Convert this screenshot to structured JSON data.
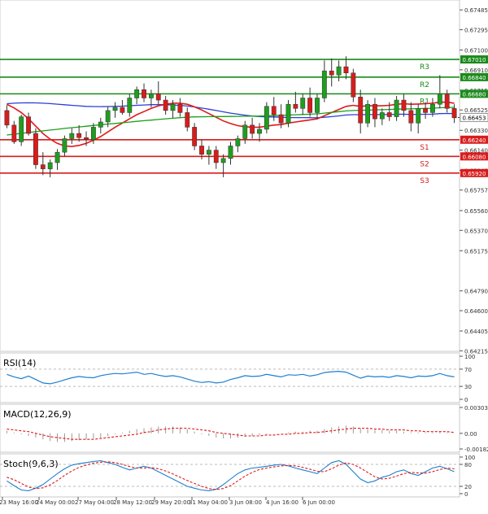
{
  "chart_data": [
    {
      "type": "candlestick",
      "title": "",
      "ylim": [
        0.6421,
        0.6758
      ],
      "y_ticks": [
        "0.67485",
        "0.67295",
        "0.67100",
        "0.66910",
        "0.66715",
        "0.66525",
        "0.66330",
        "0.66140",
        "0.65945",
        "0.65757",
        "0.65560",
        "0.65370",
        "0.65175",
        "0.64790",
        "0.64600",
        "0.64405",
        "0.64215"
      ],
      "x_ticks": [
        "23 May 16:00",
        "24 May 00:00",
        "27 May 04:00",
        "28 May 12:00",
        "29 May 20:00",
        "31 May 04:00",
        "3 Jun 08:00",
        "4 Jun 16:00",
        "6 Jun 00:00"
      ],
      "current_price": "0.66453",
      "levels": [
        {
          "name": "R3",
          "value": 0.6701,
          "label": "0.67010",
          "kind": "resistance"
        },
        {
          "name": "R2",
          "value": 0.6684,
          "label": "0.66840",
          "kind": "resistance"
        },
        {
          "name": "R1",
          "value": 0.6668,
          "label": "0.66680",
          "kind": "resistance"
        },
        {
          "name": "S1",
          "value": 0.6624,
          "label": "0.66240",
          "kind": "support"
        },
        {
          "name": "S2",
          "value": 0.6608,
          "label": "0.66080",
          "kind": "support"
        },
        {
          "name": "S3",
          "value": 0.6592,
          "label": "0.65920",
          "kind": "support"
        }
      ],
      "candles": [
        [
          0.6652,
          0.6657,
          0.6635,
          0.6638
        ],
        [
          0.6638,
          0.6642,
          0.662,
          0.6622
        ],
        [
          0.6622,
          0.6648,
          0.6618,
          0.6646
        ],
        [
          0.6646,
          0.665,
          0.6628,
          0.663
        ],
        [
          0.663,
          0.6635,
          0.6596,
          0.66
        ],
        [
          0.66,
          0.6612,
          0.659,
          0.6596
        ],
        [
          0.6596,
          0.6605,
          0.6588,
          0.6602
        ],
        [
          0.6602,
          0.6615,
          0.6595,
          0.6612
        ],
        [
          0.6612,
          0.6628,
          0.6608,
          0.6625
        ],
        [
          0.6625,
          0.6635,
          0.662,
          0.663
        ],
        [
          0.663,
          0.6638,
          0.6622,
          0.6626
        ],
        [
          0.6626,
          0.6632,
          0.6618,
          0.6624
        ],
        [
          0.6624,
          0.664,
          0.662,
          0.6636
        ],
        [
          0.6636,
          0.6645,
          0.663,
          0.6641
        ],
        [
          0.6641,
          0.6656,
          0.6636,
          0.6652
        ],
        [
          0.6652,
          0.666,
          0.6645,
          0.6655
        ],
        [
          0.6655,
          0.6662,
          0.6648,
          0.665
        ],
        [
          0.665,
          0.6668,
          0.6646,
          0.6664
        ],
        [
          0.6664,
          0.6675,
          0.6658,
          0.6672
        ],
        [
          0.6672,
          0.6678,
          0.666,
          0.6664
        ],
        [
          0.6664,
          0.6672,
          0.6655,
          0.6668
        ],
        [
          0.6668,
          0.668,
          0.6658,
          0.6662
        ],
        [
          0.6662,
          0.6666,
          0.6648,
          0.6652
        ],
        [
          0.6652,
          0.6662,
          0.6645,
          0.6658
        ],
        [
          0.6658,
          0.6664,
          0.6646,
          0.665
        ],
        [
          0.665,
          0.6655,
          0.6632,
          0.6636
        ],
        [
          0.6636,
          0.664,
          0.6614,
          0.6618
        ],
        [
          0.6618,
          0.6624,
          0.6605,
          0.661
        ],
        [
          0.661,
          0.6618,
          0.66,
          0.6614
        ],
        [
          0.6614,
          0.6618,
          0.6596,
          0.6602
        ],
        [
          0.6602,
          0.661,
          0.6588,
          0.6606
        ],
        [
          0.6606,
          0.6622,
          0.66,
          0.6618
        ],
        [
          0.6618,
          0.6628,
          0.6612,
          0.6625
        ],
        [
          0.6625,
          0.6642,
          0.662,
          0.6638
        ],
        [
          0.6638,
          0.6645,
          0.6625,
          0.663
        ],
        [
          0.663,
          0.664,
          0.6622,
          0.6634
        ],
        [
          0.6634,
          0.666,
          0.663,
          0.6656
        ],
        [
          0.6656,
          0.6665,
          0.6642,
          0.6648
        ],
        [
          0.6648,
          0.6658,
          0.6635,
          0.664
        ],
        [
          0.664,
          0.6662,
          0.6636,
          0.6658
        ],
        [
          0.6658,
          0.667,
          0.665,
          0.6654
        ],
        [
          0.6654,
          0.6668,
          0.6648,
          0.6664
        ],
        [
          0.6664,
          0.6674,
          0.6646,
          0.665
        ],
        [
          0.665,
          0.6668,
          0.6644,
          0.6664
        ],
        [
          0.6664,
          0.67,
          0.666,
          0.669
        ],
        [
          0.669,
          0.6702,
          0.6675,
          0.6686
        ],
        [
          0.6686,
          0.67,
          0.668,
          0.6694
        ],
        [
          0.6694,
          0.6704,
          0.6682,
          0.6688
        ],
        [
          0.6688,
          0.6692,
          0.666,
          0.6665
        ],
        [
          0.6665,
          0.6672,
          0.663,
          0.664
        ],
        [
          0.664,
          0.6662,
          0.6636,
          0.6658
        ],
        [
          0.6658,
          0.6664,
          0.6636,
          0.6644
        ],
        [
          0.6644,
          0.6654,
          0.6638,
          0.665
        ],
        [
          0.665,
          0.666,
          0.6642,
          0.6646
        ],
        [
          0.6646,
          0.6666,
          0.6642,
          0.6662
        ],
        [
          0.6662,
          0.6668,
          0.6646,
          0.6652
        ],
        [
          0.6652,
          0.666,
          0.6632,
          0.664
        ],
        [
          0.664,
          0.6658,
          0.663,
          0.6654
        ],
        [
          0.6654,
          0.666,
          0.6644,
          0.665
        ],
        [
          0.665,
          0.6664,
          0.6646,
          0.6658
        ],
        [
          0.6658,
          0.6686,
          0.6654,
          0.6668
        ],
        [
          0.6668,
          0.6672,
          0.665,
          0.6654
        ],
        [
          0.6654,
          0.6658,
          0.664,
          0.6645
        ]
      ],
      "moving_averages": [
        {
          "color": "#2a3fd6",
          "values": [
            0.66585,
            0.6659,
            0.66593,
            0.66594,
            0.66593,
            0.6659,
            0.66586,
            0.66581,
            0.66575,
            0.6657,
            0.66565,
            0.6656,
            0.66558,
            0.66557,
            0.66558,
            0.6656,
            0.66562,
            0.66566,
            0.6657,
            0.66573,
            0.66576,
            0.66577,
            0.66576,
            0.66573,
            0.66569,
            0.66563,
            0.66554,
            0.66543,
            0.66532,
            0.6652,
            0.66507,
            0.66495,
            0.66485,
            0.66475,
            0.66467,
            0.66462,
            0.66459,
            0.66458,
            0.66455,
            0.66453,
            0.66452,
            0.66452,
            0.66451,
            0.6645,
            0.66455,
            0.66461,
            0.66468,
            0.66477,
            0.6648,
            0.6648,
            0.66481,
            0.66481,
            0.66481,
            0.66481,
            0.66484,
            0.66485,
            0.66482,
            0.66483,
            0.66484,
            0.66485,
            0.6649,
            0.66492,
            0.6649
          ]
        },
        {
          "color": "#e01818",
          "values": [
            0.6658,
            0.66545,
            0.665,
            0.6644,
            0.6637,
            0.663,
            0.66245,
            0.66205,
            0.6618,
            0.66175,
            0.66185,
            0.66205,
            0.66235,
            0.6627,
            0.66315,
            0.6636,
            0.664,
            0.6644,
            0.6648,
            0.6651,
            0.6654,
            0.66565,
            0.6658,
            0.6659,
            0.6659,
            0.6658,
            0.66555,
            0.66525,
            0.6649,
            0.66455,
            0.6642,
            0.66395,
            0.66375,
            0.66365,
            0.6636,
            0.6636,
            0.6637,
            0.6638,
            0.66385,
            0.664,
            0.6641,
            0.6642,
            0.6643,
            0.6644,
            0.6647,
            0.665,
            0.6653,
            0.6656,
            0.6657,
            0.6656,
            0.66565,
            0.66565,
            0.66565,
            0.6657,
            0.6658,
            0.66585,
            0.6658,
            0.66582,
            0.66585,
            0.6659,
            0.666,
            0.666,
            0.6659
          ]
        },
        {
          "color": "#18a018",
          "values": [
            0.66285,
            0.66293,
            0.66301,
            0.66309,
            0.66317,
            0.66325,
            0.66333,
            0.6634,
            0.66348,
            0.66355,
            0.66362,
            0.66369,
            0.66376,
            0.66383,
            0.6639,
            0.66396,
            0.66403,
            0.66409,
            0.66416,
            0.66422,
            0.66428,
            0.66434,
            0.6644,
            0.66446,
            0.66451,
            0.66456,
            0.66459,
            0.6646,
            0.66461,
            0.66462,
            0.66462,
            0.66463,
            0.66464,
            0.66465,
            0.66466,
            0.66467,
            0.66469,
            0.66471,
            0.66473,
            0.66476,
            0.66479,
            0.66482,
            0.66485,
            0.66488,
            0.66495,
            0.66502,
            0.66509,
            0.66516,
            0.6652,
            0.66522,
            0.66524,
            0.66526,
            0.66528,
            0.6653,
            0.66533,
            0.66535,
            0.66536,
            0.66538,
            0.6654,
            0.66542,
            0.66546,
            0.66549,
            0.6655
          ]
        }
      ]
    },
    {
      "type": "line",
      "title": "RSI(14)",
      "ylim": [
        0,
        100
      ],
      "y_ticks": [
        "100",
        "70",
        "30",
        "0"
      ],
      "levels": [
        70,
        30
      ],
      "series": [
        {
          "values": [
            58,
            52,
            48,
            54,
            46,
            38,
            36,
            40,
            45,
            50,
            53,
            51,
            50,
            55,
            58,
            60,
            59,
            61,
            63,
            58,
            60,
            56,
            53,
            55,
            52,
            47,
            42,
            39,
            41,
            38,
            40,
            46,
            50,
            55,
            53,
            54,
            58,
            55,
            52,
            57,
            56,
            58,
            54,
            57,
            62,
            64,
            65,
            63,
            56,
            49,
            54,
            52,
            53,
            51,
            55,
            53,
            50,
            54,
            53,
            55,
            60,
            55,
            52
          ]
        }
      ]
    },
    {
      "type": "bar",
      "title": "MACD(12,26,9)",
      "ylim": [
        -0.001826,
        0.003034
      ],
      "y_ticks": [
        "0.003034",
        "0.00",
        "-0.001826"
      ],
      "series": [
        {
          "values": [
            0.0003,
            0.0001,
            -0.0001,
            -0.0003,
            -0.0005,
            -0.0007,
            -0.0009,
            -0.001,
            -0.001,
            -0.0009,
            -0.0008,
            -0.0007,
            -0.0006,
            -0.0005,
            -0.0003,
            -0.0001,
            0.0001,
            0.0003,
            0.0005,
            0.0006,
            0.0007,
            0.0008,
            0.0008,
            0.0008,
            0.0007,
            0.0005,
            0.0002,
            -0.0001,
            -0.0003,
            -0.0005,
            -0.0006,
            -0.0006,
            -0.0005,
            -0.0004,
            -0.0003,
            -0.0002,
            -0.0001,
            0.0,
            0.0,
            0.0001,
            0.0002,
            0.0002,
            0.0003,
            0.0003,
            0.0005,
            0.0007,
            0.0008,
            0.0009,
            0.0008,
            0.0006,
            0.0005,
            0.0004,
            0.0004,
            0.0003,
            0.0003,
            0.0002,
            0.0001,
            0.0001,
            0.0001,
            0.0001,
            0.0002,
            0.0001,
            0.0
          ]
        },
        {
          "values": [
            0.0005,
            0.0004,
            0.0003,
            0.0002,
            0.0,
            -0.0002,
            -0.0004,
            -0.0005,
            -0.0006,
            -0.0007,
            -0.0007,
            -0.0007,
            -0.0007,
            -0.0006,
            -0.0005,
            -0.0004,
            -0.0003,
            -0.0002,
            -0.0001,
            0.0001,
            0.0002,
            0.0004,
            0.0005,
            0.0006,
            0.0006,
            0.0006,
            0.0005,
            0.0004,
            0.0003,
            0.0001,
            0.0,
            -0.0001,
            -0.0002,
            -0.0003,
            -0.0003,
            -0.0003,
            -0.0002,
            -0.0002,
            -0.0001,
            -0.0001,
            0.0,
            0.0,
            0.0001,
            0.0001,
            0.0002,
            0.0003,
            0.0004,
            0.0005,
            0.0006,
            0.0006,
            0.0006,
            0.0005,
            0.0005,
            0.0004,
            0.0004,
            0.0004,
            0.0003,
            0.0003,
            0.0002,
            0.0002,
            0.0002,
            0.0002,
            0.0001
          ]
        }
      ]
    },
    {
      "type": "line",
      "title": "Stoch(9,6,3)",
      "ylim": [
        0,
        100
      ],
      "y_ticks": [
        "100",
        "80",
        "20",
        "0"
      ],
      "levels": [
        80,
        20
      ],
      "series": [
        {
          "color": "#1d7fd0",
          "values": [
            35,
            22,
            10,
            8,
            15,
            25,
            40,
            55,
            68,
            78,
            82,
            85,
            88,
            90,
            85,
            80,
            72,
            65,
            70,
            75,
            70,
            60,
            50,
            40,
            30,
            20,
            15,
            10,
            8,
            12,
            25,
            40,
            55,
            65,
            70,
            72,
            75,
            78,
            80,
            76,
            70,
            65,
            60,
            55,
            70,
            85,
            90,
            80,
            60,
            40,
            30,
            35,
            45,
            50,
            60,
            65,
            55,
            50,
            60,
            70,
            75,
            68,
            60
          ]
        },
        {
          "color": "#e01818",
          "values": [
            45,
            38,
            28,
            18,
            14,
            16,
            24,
            36,
            50,
            62,
            72,
            78,
            83,
            86,
            87,
            85,
            80,
            74,
            70,
            70,
            71,
            68,
            62,
            54,
            45,
            36,
            28,
            20,
            14,
            11,
            14,
            22,
            35,
            48,
            58,
            66,
            70,
            73,
            76,
            77,
            76,
            72,
            67,
            61,
            60,
            68,
            78,
            84,
            80,
            70,
            58,
            46,
            40,
            42,
            48,
            55,
            58,
            57,
            56,
            60,
            66,
            70,
            68
          ]
        }
      ]
    }
  ]
}
